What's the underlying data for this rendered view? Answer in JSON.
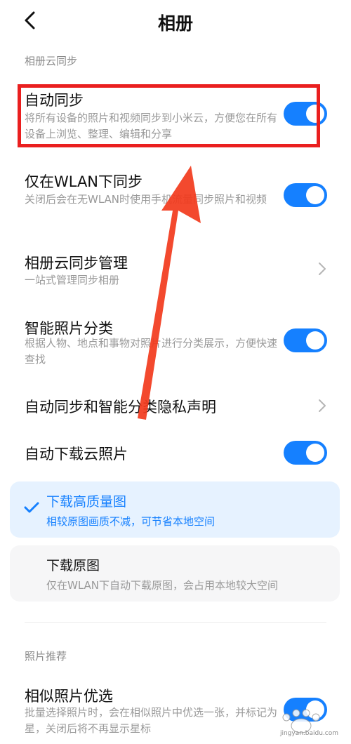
{
  "header": {
    "title": "相册"
  },
  "sections": {
    "cloud_sync": "相册云同步",
    "photo_recommend": "照片推荐"
  },
  "rows": {
    "auto_sync": {
      "title": "自动同步",
      "desc": "将所有设备的照片和视频同步到小米云，方便您在所有设备上浏览、整理、编辑和分享",
      "on": true
    },
    "wlan_only": {
      "title": "仅在WLAN下同步",
      "desc": "关闭后会在无WLAN时使用手机流量同步照片和视频",
      "on": true
    },
    "sync_manage": {
      "title": "相册云同步管理",
      "desc": "一站式管理同步相册"
    },
    "smart_classify": {
      "title": "智能照片分类",
      "desc": "根据人物、地点和事物对照片进行分类展示，方便快速查找",
      "on": true
    },
    "privacy": {
      "title": "自动同步和智能分类隐私声明"
    },
    "auto_download": {
      "title": "自动下载云照片",
      "on": true
    },
    "similar": {
      "title": "相似照片优选",
      "desc": "批量选择照片时，会在相似照片中优选一张，并标记为星，关闭后将不再显示星标",
      "on": true
    }
  },
  "download_options": [
    {
      "title": "下载高质量图",
      "desc": "相较原图画质不减，可节省本地空间",
      "selected": true
    },
    {
      "title": "下载原图",
      "desc": "仅在WLAN下自动下载原图，会占用本地较大空间",
      "selected": false
    }
  ],
  "colors": {
    "accent": "#1580ff",
    "annotation": "#ea1f1f"
  },
  "icons": {
    "back": "chevron-left-icon",
    "chevron": "chevron-right-icon",
    "check": "checkmark-icon"
  }
}
